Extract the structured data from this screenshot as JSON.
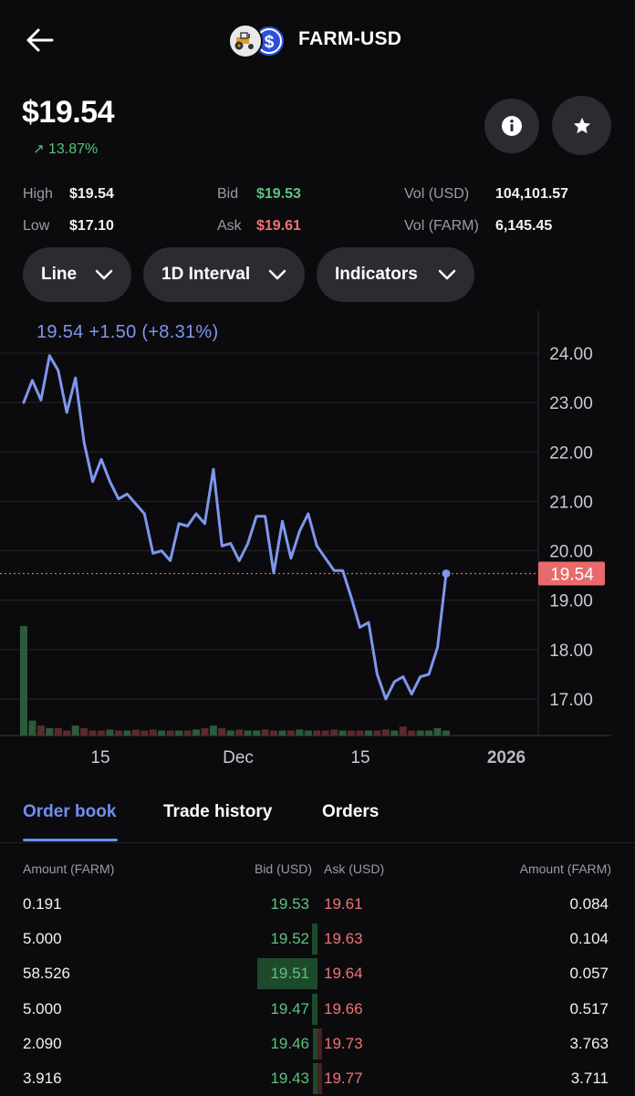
{
  "header": {
    "title": "FARM-USD",
    "back_icon": "arrow-left-icon",
    "logo_icons": [
      "tractor-icon",
      "usd-coin-icon"
    ]
  },
  "summary": {
    "price": "$19.54",
    "change": "13.87%",
    "change_color": "#55c37e",
    "info_icon": "info-icon",
    "star_icon": "star-icon"
  },
  "stats": {
    "high_label": "High",
    "high_value": "$19.54",
    "low_label": "Low",
    "low_value": "$17.10",
    "bid_label": "Bid",
    "bid_value": "$19.53",
    "ask_label": "Ask",
    "ask_value": "$19.61",
    "vol_usd_label": "Vol (USD)",
    "vol_usd_value": "104,101.57",
    "vol_farm_label": "Vol (FARM)",
    "vol_farm_value": "6,145.45"
  },
  "controls": {
    "chart_type": "Line",
    "interval": "1D Interval",
    "indicators": "Indicators"
  },
  "chart_data": {
    "type": "line",
    "readout": "19.54  +1.50 (+8.31%)",
    "current_value": 19.54,
    "current_label": "19.54",
    "line_color": "#7f96ef",
    "current_marker_color": "#e86262",
    "ylim": [
      16.3,
      24.3
    ],
    "y_ticks": [
      "24.00",
      "23.00",
      "22.00",
      "21.00",
      "20.00",
      "19.00",
      "18.00",
      "17.00"
    ],
    "y_tick_values": [
      24,
      23,
      22,
      21,
      20,
      19,
      18,
      17
    ],
    "x_ticks": [
      "15",
      "Dec",
      "15",
      "2026"
    ],
    "x_tick_index": [
      9,
      26,
      41,
      58
    ],
    "values": [
      23.0,
      23.45,
      23.05,
      23.95,
      23.65,
      22.8,
      23.5,
      22.2,
      21.4,
      21.85,
      21.4,
      21.05,
      21.15,
      20.95,
      20.75,
      19.95,
      20.0,
      19.8,
      20.55,
      20.5,
      20.75,
      20.55,
      21.65,
      20.1,
      20.15,
      19.8,
      20.15,
      20.7,
      20.7,
      19.55,
      20.6,
      19.85,
      20.4,
      20.75,
      20.1,
      19.85,
      19.6,
      19.6,
      19.05,
      18.45,
      18.55,
      17.5,
      17.0,
      17.35,
      17.45,
      17.1,
      17.45,
      17.5,
      18.05,
      19.54
    ],
    "volumes": [
      0.22,
      0.03,
      0.02,
      0.015,
      0.015,
      0.01,
      0.02,
      0.015,
      0.01,
      0.01,
      0.012,
      0.01,
      0.01,
      0.012,
      0.01,
      0.012,
      0.01,
      0.01,
      0.01,
      0.01,
      0.012,
      0.015,
      0.02,
      0.015,
      0.01,
      0.012,
      0.01,
      0.01,
      0.012,
      0.01,
      0.01,
      0.01,
      0.012,
      0.01,
      0.01,
      0.01,
      0.012,
      0.01,
      0.01,
      0.01,
      0.01,
      0.01,
      0.012,
      0.01,
      0.018,
      0.01,
      0.01,
      0.01,
      0.015,
      0.01
    ],
    "volume_up": [
      true,
      true,
      false,
      true,
      false,
      false,
      true,
      false,
      false,
      false,
      true,
      false,
      true,
      false,
      false,
      false,
      true,
      false,
      true,
      false,
      true,
      false,
      true,
      false,
      true,
      false,
      true,
      true,
      false,
      false,
      true,
      false,
      true,
      true,
      false,
      false,
      false,
      true,
      false,
      false,
      true,
      false,
      false,
      true,
      false,
      false,
      true,
      true,
      true,
      true
    ]
  },
  "tabs": [
    {
      "label": "Order book"
    },
    {
      "label": "Trade history"
    },
    {
      "label": "Orders"
    }
  ],
  "orderbook": {
    "headers": {
      "amount_left": "Amount (FARM)",
      "bid": "Bid (USD)",
      "ask": "Ask (USD)",
      "amount_right": "Amount (FARM)"
    },
    "rows": [
      {
        "amt_l": "0.191",
        "bid": "19.53",
        "ask": "19.61",
        "amt_r": "0.084",
        "bid_depth": 0.0,
        "ask_depth": 0.0
      },
      {
        "amt_l": "5.000",
        "bid": "19.52",
        "ask": "19.63",
        "amt_r": "0.104",
        "bid_depth": 0.09,
        "ask_depth": 0.0
      },
      {
        "amt_l": "58.526",
        "bid": "19.51",
        "ask": "19.64",
        "amt_r": "0.057",
        "bid_depth": 1.0,
        "ask_depth": 0.0
      },
      {
        "amt_l": "5.000",
        "bid": "19.47",
        "ask": "19.66",
        "amt_r": "0.517",
        "bid_depth": 0.09,
        "ask_depth": 0.0
      },
      {
        "amt_l": "2.090",
        "bid": "19.46",
        "ask": "19.73",
        "amt_r": "3.763",
        "bid_depth": 0.04,
        "ask_depth": 0.08
      },
      {
        "amt_l": "3.916",
        "bid": "19.43",
        "ask": "19.77",
        "amt_r": "3.711",
        "bid_depth": 0.07,
        "ask_depth": 0.08
      }
    ]
  }
}
